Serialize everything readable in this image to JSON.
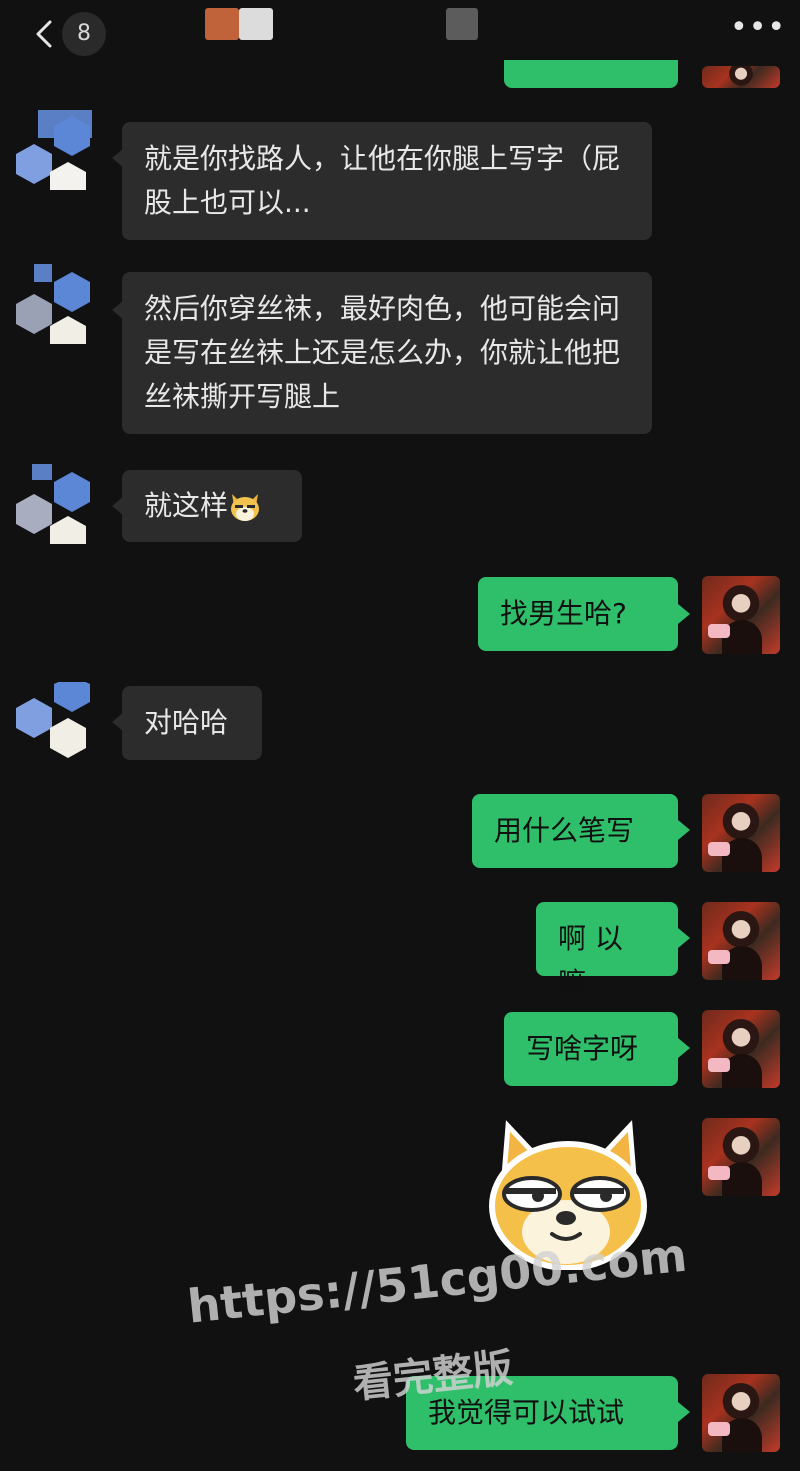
{
  "header": {
    "back_icon": "chevron-left-icon",
    "unread_count": "8",
    "more_icon": "ellipsis-icon",
    "more_label": "•••"
  },
  "messages": [
    {
      "side": "in",
      "text": "就是你找路人，让他在你腿上写字（屁股上也可以..."
    },
    {
      "side": "in",
      "text": "然后你穿丝袜，最好肉色，他可能会问是写在丝袜上还是怎么办，你就让他把丝袜撕开写腿上"
    },
    {
      "side": "in",
      "text": "就这样",
      "emoji": "doge-face-icon"
    },
    {
      "side": "out",
      "text": "找男生哈?"
    },
    {
      "side": "in",
      "text": "对哈哈"
    },
    {
      "side": "out",
      "text": "用什么笔写"
    },
    {
      "side": "out",
      "text": "啊 以 嘛"
    },
    {
      "side": "out",
      "text": "写啥字呀"
    },
    {
      "side": "out",
      "sticker": "doge-sticker-icon"
    },
    {
      "side": "out",
      "text": "我觉得可以试试"
    }
  ],
  "watermark": {
    "url": "https://51cg00.com",
    "sub": "看完整版"
  },
  "colors": {
    "background": "#111111",
    "incoming_bubble": "#2c2c2c",
    "outgoing_bubble": "#2fbf6b"
  }
}
